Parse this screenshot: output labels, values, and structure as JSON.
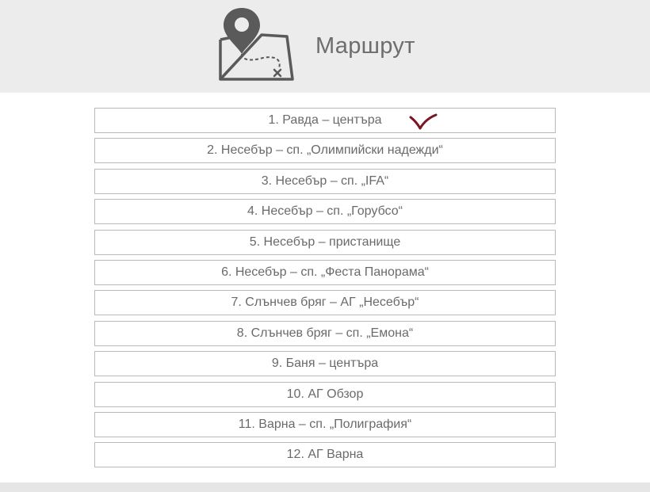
{
  "header": {
    "title": "Маршрут",
    "icon": "map-pin-route-icon"
  },
  "routes": [
    {
      "label": "1. Равда – центъра",
      "checked": true
    },
    {
      "label": "2. Несебър – сп. „Олимпийски надежди“"
    },
    {
      "label": "3. Несебър – сп. „IFA“"
    },
    {
      "label": "4. Несебър – сп. „Горубсо“"
    },
    {
      "label": "5. Несебър – пристанище"
    },
    {
      "label": "6. Несебър – сп. „Феста Панорама“"
    },
    {
      "label": "7. Слънчев бряг – АГ „Несебър“"
    },
    {
      "label": "8. Слънчев бряг – сп. „Емона“"
    },
    {
      "label": "9. Баня – центъра"
    },
    {
      "label": "10. АГ Обзор"
    },
    {
      "label": "11. Варна – сп. „Полиграфия“"
    },
    {
      "label": "12. АГ Варна"
    }
  ],
  "colors": {
    "header_bg": "#ececec",
    "text": "#6a6a6a",
    "border": "#b9b9b9",
    "icon": "#5a5a5a",
    "check": "#7a1622"
  }
}
